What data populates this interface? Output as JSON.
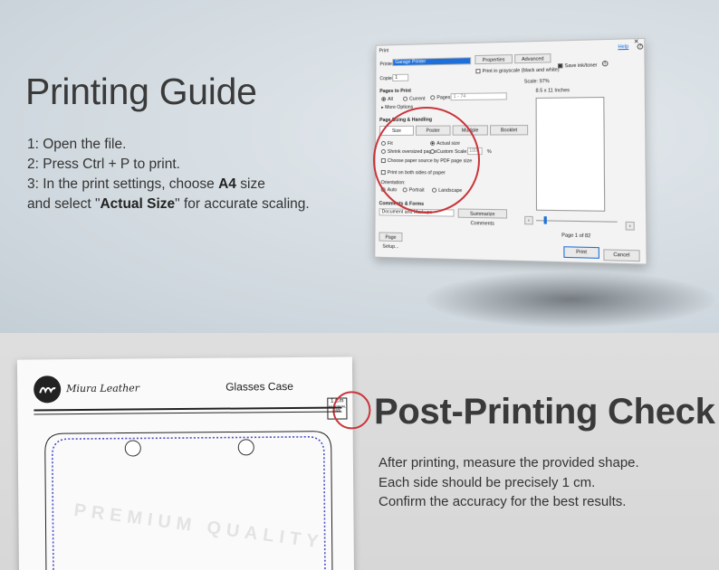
{
  "guide": {
    "title": "Printing Guide",
    "step1": "1: Open the file.",
    "step2": "2: Press Ctrl + P to print.",
    "step3_pre": "3: In the print settings, choose ",
    "step3_bold": "A4",
    "step3_post": " size",
    "step4_pre": "and select \"",
    "step4_bold": "Actual Size",
    "step4_post": "\" for accurate scaling."
  },
  "dialog": {
    "title": "Print",
    "help": "Help",
    "printer_label": "Printer:",
    "printer_value": "Garage Printer",
    "properties": "Properties",
    "advanced": "Advanced",
    "copies_label": "Copies:",
    "copies_value": "1",
    "grayscale": "Print in grayscale (black and white)",
    "save_ink": "Save ink/toner",
    "pages_header": "Pages to Print",
    "all": "All",
    "current": "Current",
    "pages": "Pages",
    "pages_range": "1 - 74",
    "more_options": "More Options",
    "sizing_header": "Page Sizing & Handling",
    "tab_size": "Size",
    "tab_poster": "Poster",
    "tab_multiple": "Multiple",
    "tab_booklet": "Booklet",
    "fit": "Fit",
    "actual_size": "Actual size",
    "shrink": "Shrink oversized pages",
    "custom_scale": "Custom Scale:",
    "custom_value": "100",
    "percent": "%",
    "paper_source": "Choose paper source by PDF page size",
    "both_sides": "Print on both sides of paper",
    "orientation": "Orientation:",
    "auto": "Auto",
    "portrait": "Portrait",
    "landscape": "Landscape",
    "comments_header": "Comments & Forms",
    "comments_value": "Document and Markups",
    "summarize": "Summarize Comments",
    "scale_readout": "Scale: 97%",
    "paper_size": "8.5 x 11 Inches",
    "page_info": "Page 1 of 82",
    "page_setup": "Page Setup...",
    "print": "Print",
    "cancel": "Cancel"
  },
  "template": {
    "brand": "Miura Leather",
    "title": "Glasses Case",
    "scale_label": "1 Cm",
    "scale_inner": "A4 ACTUAL SIZE",
    "watermark": "PREMIUM QUALITY"
  },
  "post": {
    "title": "Post-Printing Check",
    "line1": "After printing, measure the provided shape.",
    "line2": "Each side should be precisely 1 cm.",
    "line3": "Confirm the accuracy for the best results."
  },
  "colors": {
    "accent_red": "#c9353b",
    "stitch_blue": "#4a4fc4",
    "printer_highlight": "#1e6fd9"
  }
}
